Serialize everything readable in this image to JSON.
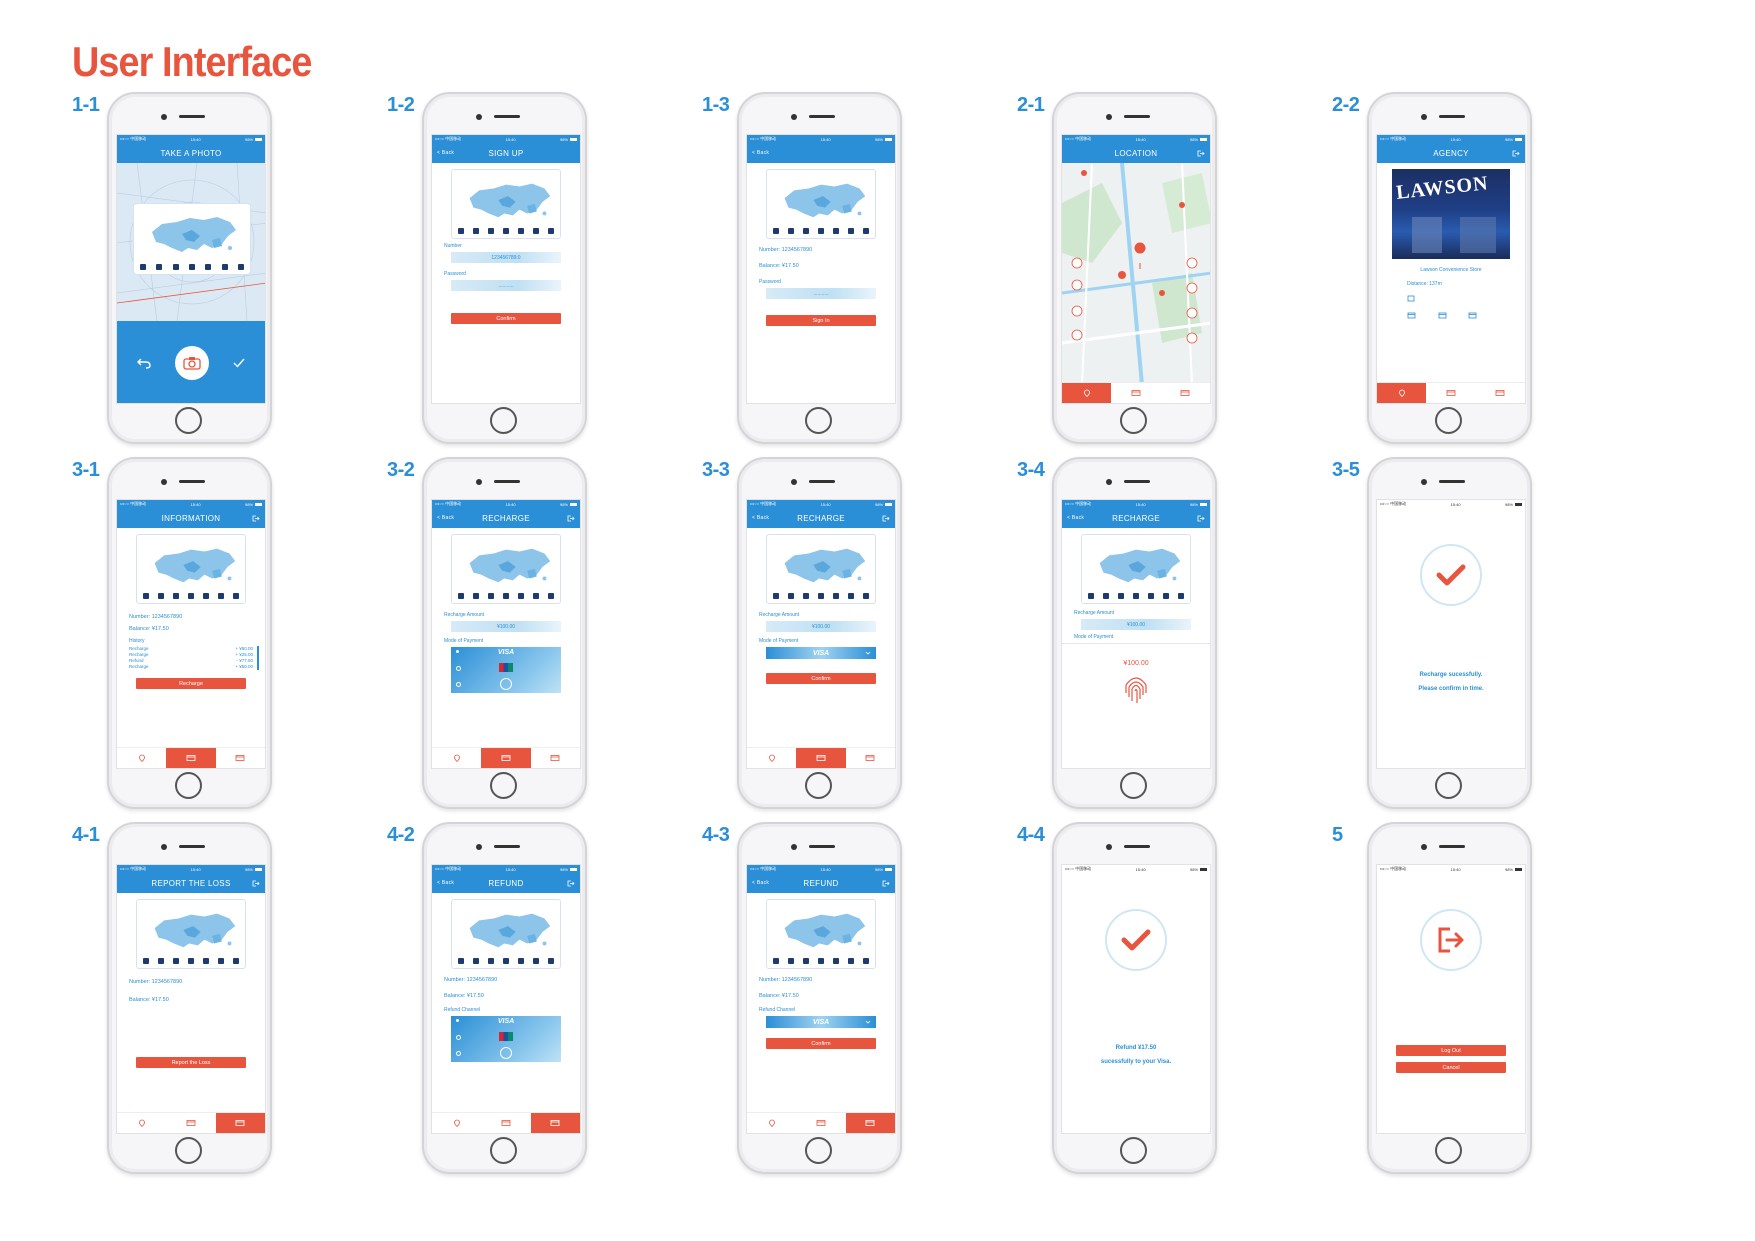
{
  "page_title": "User Interface",
  "colors": {
    "accent": "#e8553f",
    "blue": "#2a8fd6"
  },
  "screens": {
    "s1_1": {
      "label": "1-1",
      "nav_title": "TAKE A PHOTO"
    },
    "s1_2": {
      "label": "1-2",
      "back": "< Back",
      "nav_title": "SIGN UP",
      "number_label": "Number",
      "number_value": "123456789:0",
      "password_label": "Password",
      "password_value": "...........",
      "confirm": "Confirm"
    },
    "s1_3": {
      "label": "1-3",
      "back": "< Back",
      "number": "Number: 1234567890",
      "balance": "Balance: ¥17.50",
      "password_label": "Password",
      "password_value": "...........",
      "signin": "Sign In"
    },
    "s2_1": {
      "label": "2-1",
      "nav_title": "LOCATION"
    },
    "s2_2": {
      "label": "2-2",
      "nav_title": "AGENCY",
      "store_sign": "LAWSON",
      "store_name": "Lawson Convenience Store",
      "distance": "Distance: 137m"
    },
    "s3_1": {
      "label": "3-1",
      "nav_title": "INFORMATION",
      "number": "Number: 1234567890",
      "balance": "Balance: ¥17.50",
      "history_label": "History",
      "history": [
        {
          "type": "Recharge",
          "amount": "+ ¥50.00"
        },
        {
          "type": "Recharge",
          "amount": "+ ¥25.00"
        },
        {
          "type": "Refund",
          "amount": "- ¥77.50"
        },
        {
          "type": "Recharge",
          "amount": "+ ¥50.00"
        }
      ],
      "recharge_btn": "Recharge"
    },
    "s3_2": {
      "label": "3-2",
      "back": "< Back",
      "nav_title": "RECHARGE",
      "amount_label": "Recharge Amount",
      "amount_value": "¥100.00",
      "payment_label": "Mode of Payment",
      "visa": "VISA"
    },
    "s3_3": {
      "label": "3-3",
      "back": "< Back",
      "nav_title": "RECHARGE",
      "amount_label": "Recharge Amount",
      "amount_value": "¥100.00",
      "payment_label": "Mode of Payment",
      "visa": "VISA",
      "confirm": "Confirm"
    },
    "s3_4": {
      "label": "3-4",
      "back": "< Back",
      "nav_title": "RECHARGE",
      "amount_label": "Recharge Amount",
      "amount_value": "¥100.00",
      "payment_label": "Mode of Payment",
      "pay_amount": "¥100.00"
    },
    "s3_5": {
      "label": "3-5",
      "msg1": "Recharge sucessfully.",
      "msg2": "Please confirm in time."
    },
    "s4_1": {
      "label": "4-1",
      "nav_title": "REPORT THE LOSS",
      "number": "Number: 1234567890",
      "balance": "Balance: ¥17.50",
      "report_btn": "Report the Loss"
    },
    "s4_2": {
      "label": "4-2",
      "back": "< Back",
      "nav_title": "REFUND",
      "number": "Number: 1234567890",
      "balance": "Balance: ¥17.50",
      "channel_label": "Refund Channel",
      "visa": "VISA"
    },
    "s4_3": {
      "label": "4-3",
      "back": "< Back",
      "nav_title": "REFUND",
      "number": "Number: 1234567890",
      "balance": "Balance: ¥17.50",
      "channel_label": "Refund Channel",
      "visa": "VISA",
      "confirm": "Confirm"
    },
    "s4_4": {
      "label": "4-4",
      "msg1": "Refund ¥17.50",
      "msg2": "sucessfully to your Visa."
    },
    "s5": {
      "label": "5",
      "logout": "Log Out",
      "cancel": "Cancel"
    }
  },
  "status_bar": {
    "carrier": "•••○○ 中国移动",
    "time": "15:40",
    "battery": "98%"
  }
}
